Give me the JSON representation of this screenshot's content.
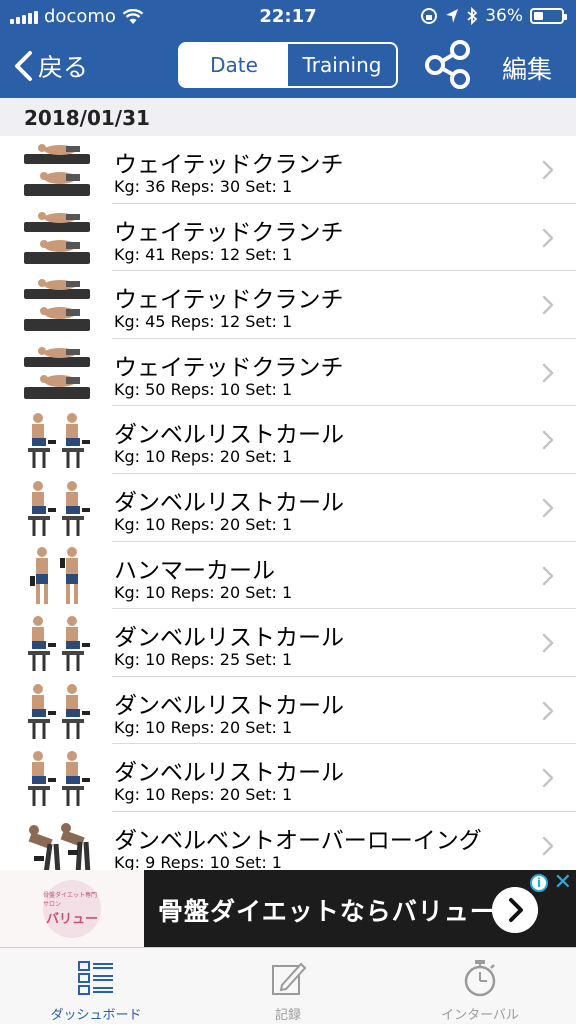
{
  "status_bar": {
    "carrier": "docomo",
    "time": "22:17",
    "battery_percent": "36%",
    "battery_level": 0.36
  },
  "nav": {
    "back_label": "戻る",
    "segments": [
      "Date",
      "Training"
    ],
    "active_segment": "Date",
    "share_icon": "share-icon",
    "edit_label": "編集"
  },
  "section": {
    "date": "2018/01/31"
  },
  "entries": [
    {
      "name": "ウェイテッドクランチ",
      "detail": "Kg: 36 Reps: 30 Set: 1",
      "image": "crunch"
    },
    {
      "name": "ウェイテッドクランチ",
      "detail": "Kg: 41 Reps: 12 Set: 1",
      "image": "crunch"
    },
    {
      "name": "ウェイテッドクランチ",
      "detail": "Kg: 45 Reps: 12 Set: 1",
      "image": "crunch"
    },
    {
      "name": "ウェイテッドクランチ",
      "detail": "Kg: 50 Reps: 10 Set: 1",
      "image": "crunch"
    },
    {
      "name": "ダンベルリストカール",
      "detail": "Kg: 10 Reps: 20 Set: 1",
      "image": "wrist-curl"
    },
    {
      "name": "ダンベルリストカール",
      "detail": "Kg: 10 Reps: 20 Set: 1",
      "image": "wrist-curl"
    },
    {
      "name": "ハンマーカール",
      "detail": "Kg: 10 Reps: 20 Set: 1",
      "image": "hammer-curl"
    },
    {
      "name": "ダンベルリストカール",
      "detail": "Kg: 10 Reps: 25 Set: 1",
      "image": "wrist-curl"
    },
    {
      "name": "ダンベルリストカール",
      "detail": "Kg: 10 Reps: 20 Set: 1",
      "image": "wrist-curl"
    },
    {
      "name": "ダンベルリストカール",
      "detail": "Kg: 10 Reps: 20 Set: 1",
      "image": "wrist-curl"
    },
    {
      "name": "ダンベルベントオーバーローイング",
      "detail": "Kg: 9 Reps: 10 Set: 1",
      "image": "bent-over-row"
    }
  ],
  "ad": {
    "brand": "バリュー",
    "brand_caption": "骨盤ダイエット専門サロン",
    "text": "骨盤ダイエットならバリュー"
  },
  "tabs": [
    {
      "label": "ダッシュボード",
      "icon": "dashboard-icon",
      "active": true
    },
    {
      "label": "記録",
      "icon": "record-icon",
      "active": false
    },
    {
      "label": "インターバル",
      "icon": "stopwatch-icon",
      "active": false
    }
  ],
  "colors": {
    "primary": "#2b5fa8",
    "separator": "#d9d9de",
    "section_bg": "#efeff4",
    "ad_bg": "#1c1c1c",
    "ad_accent": "#2ea7de"
  }
}
